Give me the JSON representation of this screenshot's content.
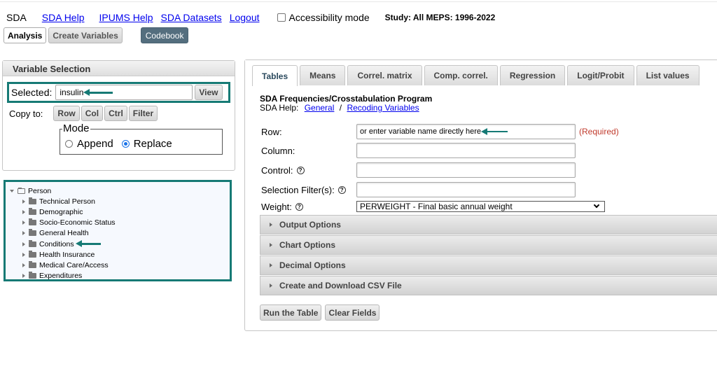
{
  "nav": {
    "brand": "SDA",
    "links": [
      "SDA Help",
      "IPUMS Help",
      "SDA Datasets",
      "Logout"
    ],
    "accessibility_label": "Accessibility mode",
    "accessibility_checked": false,
    "study": "Study: All MEPS: 1996-2022"
  },
  "mode_buttons": {
    "analysis": "Analysis",
    "create_variables": "Create Variables",
    "codebook": "Codebook"
  },
  "variable_selection": {
    "title": "Variable Selection",
    "selected_label": "Selected:",
    "selected_value": "insulin",
    "view_button": "View",
    "copy_to_label": "Copy to:",
    "copy_buttons": [
      "Row",
      "Col",
      "Ctrl",
      "Filter"
    ],
    "mode_legend": "Mode",
    "mode_options": [
      "Append",
      "Replace"
    ],
    "mode_selected": "Replace"
  },
  "tree": {
    "root": "Person",
    "children": [
      "Technical Person",
      "Demographic",
      "Socio-Economic Status",
      "General Health",
      "Conditions",
      "Health Insurance",
      "Medical Care/Access",
      "Expenditures"
    ],
    "highlighted": "Conditions"
  },
  "main": {
    "tabs": [
      "Tables",
      "Means",
      "Correl. matrix",
      "Comp. correl.",
      "Regression",
      "Logit/Probit",
      "List values"
    ],
    "active_tab": "Tables",
    "program_title": "SDA Frequencies/Crosstabulation Program",
    "help_label": "SDA Help:",
    "help_links": [
      "General",
      "Recoding Variables"
    ],
    "help_separator": "/",
    "fields": {
      "row_label": "Row:",
      "row_placeholder": "or enter variable name directly here",
      "row_required": "(Required)",
      "column_label": "Column:",
      "control_label": "Control:",
      "filter_label": "Selection Filter(s):",
      "weight_label": "Weight:",
      "weight_value": "PERWEIGHT - Final basic annual weight"
    },
    "accordions": [
      "Output Options",
      "Chart Options",
      "Decimal Options",
      "Create and Download CSV File"
    ],
    "run_button": "Run the Table",
    "clear_button": "Clear Fields"
  },
  "colors": {
    "highlight_border": "#167a75",
    "codebook_bg": "#546e7e",
    "required": "#c0392b",
    "link": "#0000ee"
  }
}
